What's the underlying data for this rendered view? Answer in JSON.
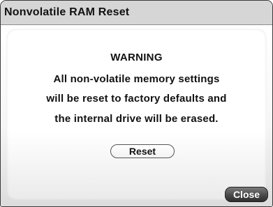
{
  "dialog": {
    "title": "Nonvolatile RAM Reset",
    "warning_heading": "WARNING",
    "message_lines": [
      "All non-volatile memory settings",
      "will be reset to factory defaults and",
      "the internal drive will be erased."
    ],
    "reset_label": "Reset",
    "close_label": "Close"
  }
}
